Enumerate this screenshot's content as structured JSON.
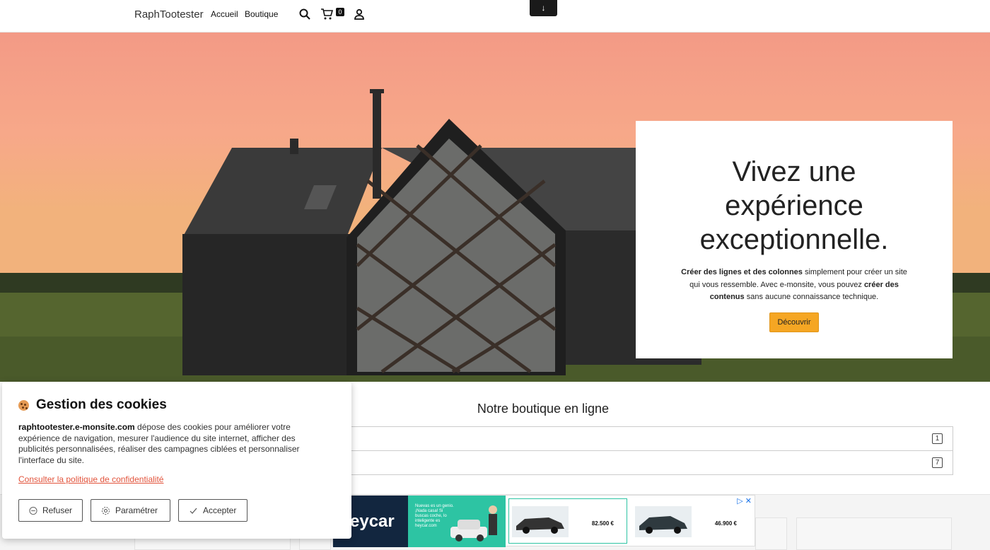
{
  "header": {
    "brand": "RaphTootester",
    "nav": [
      "Accueil",
      "Boutique"
    ],
    "cart_count": "0",
    "scroll_tab": "↓"
  },
  "hero": {
    "title": "Vivez une expérience exceptionnelle.",
    "text_bold_1": "Créer des lignes et des colonnes",
    "text_1": " simplement pour créer un site qui vous ressemble. Avec e-monsite, vous pouvez ",
    "text_bold_2": "créer des contenus",
    "text_2": " sans aucune connaissance technique.",
    "button": "Découvrir"
  },
  "shop": {
    "title": "Notre boutique en ligne",
    "rows": [
      {
        "count": "1"
      },
      {
        "count": "7"
      }
    ]
  },
  "cookie": {
    "title": "Gestion des cookies",
    "site": "raphtootester.e-monsite.com",
    "text": " dépose des cookies pour améliorer votre expérience de navigation, mesurer l'audience du site internet, afficher des publicités personnalisées, réaliser des campagnes ciblées et personnaliser l'interface du site.",
    "link": "Consulter la politique de confidentialité",
    "buttons": {
      "refuse": "Refuser",
      "settings": "Paramétrer",
      "accept": "Accepter"
    }
  },
  "ad": {
    "brand": "eycar",
    "tagline": "Nuevas es un genio. ¡Nada casa! Si buscas coche, lo inteligente es heycar.com",
    "prices": [
      "82.500 €",
      "46.900 €"
    ]
  }
}
